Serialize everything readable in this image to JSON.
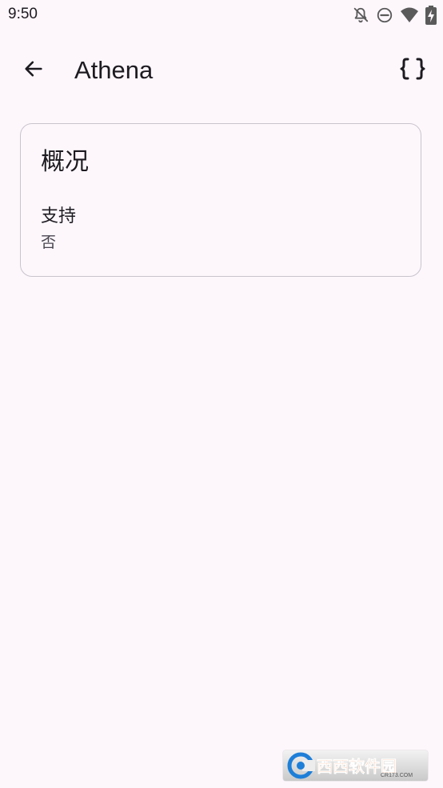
{
  "status_bar": {
    "time": "9:50",
    "icons": [
      "bell-off-icon",
      "do-not-disturb-icon",
      "wifi-icon",
      "battery-charging-icon"
    ]
  },
  "top_bar": {
    "title": "Athena",
    "back_icon": "arrow-back-icon",
    "action_icon": "json-braces-icon"
  },
  "card": {
    "title": "概况",
    "fields": [
      {
        "label": "支持",
        "value": "否"
      }
    ]
  },
  "watermark": {
    "text": "西西软件园",
    "subtext": "CR173.COM"
  },
  "colors": {
    "background": "#FDF7FC",
    "text_primary": "#1D1B20",
    "text_secondary": "#49454F",
    "card_border": "#C9C4CC",
    "watermark_orange": "#F26A1B",
    "watermark_blue": "#1E7FD8"
  }
}
